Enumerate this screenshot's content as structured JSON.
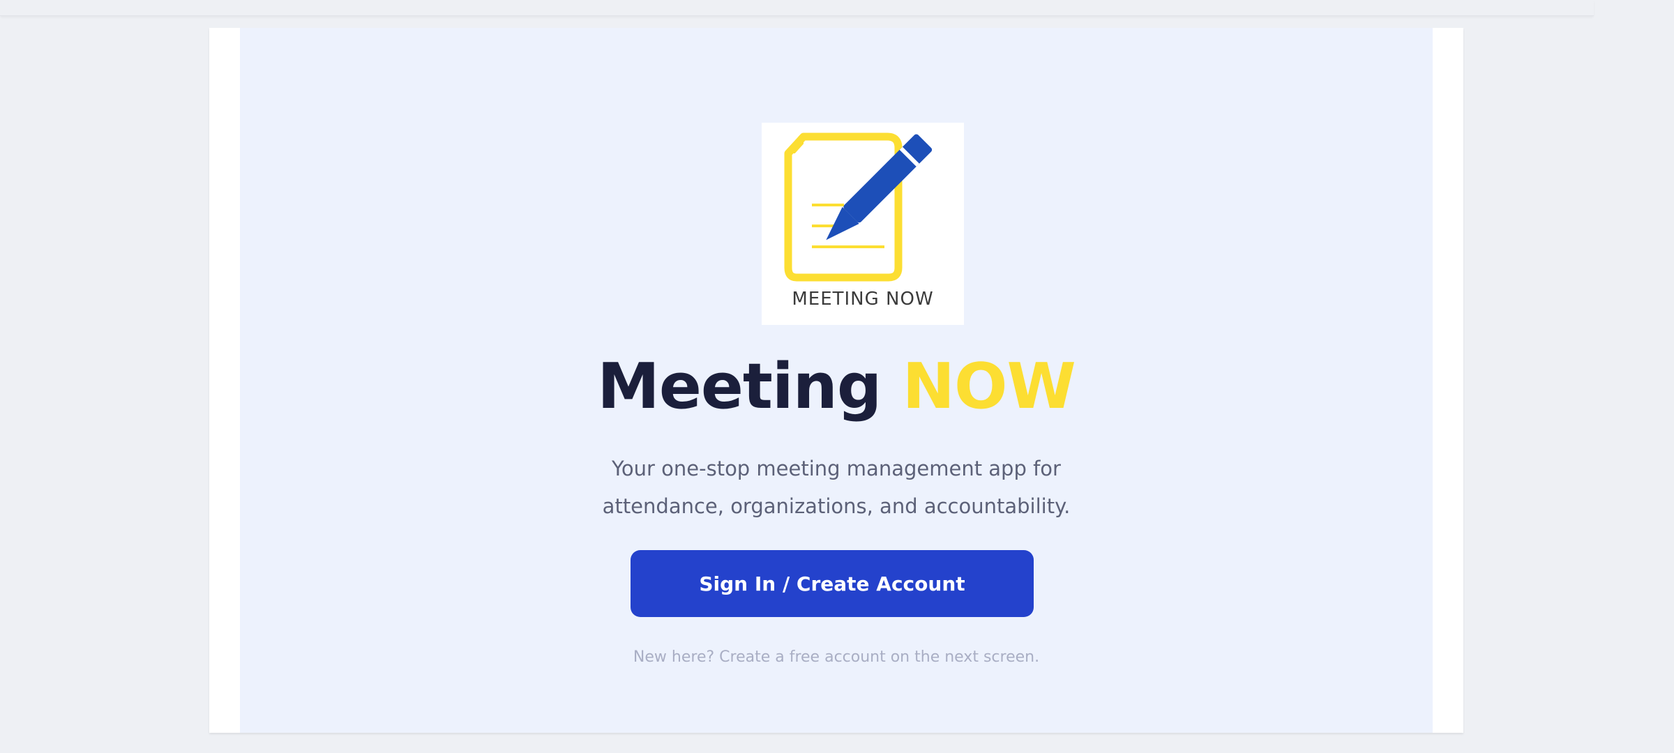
{
  "logo": {
    "caption": "MEETING NOW",
    "icon": "document-pencil-icon"
  },
  "hero": {
    "title_main": "Meeting",
    "title_accent": "NOW",
    "subtitle": "Your one-stop meeting management app for attendance, organizations, and accountability."
  },
  "actions": {
    "signin_label": "Sign In / Create Account"
  },
  "footer": {
    "hint": "New here? Create a free account on the next screen."
  },
  "colors": {
    "accent_yellow": "#fcde32",
    "button_blue": "#2442cc",
    "title_dark": "#1b1f3b",
    "panel_bg": "#edf2fd"
  }
}
